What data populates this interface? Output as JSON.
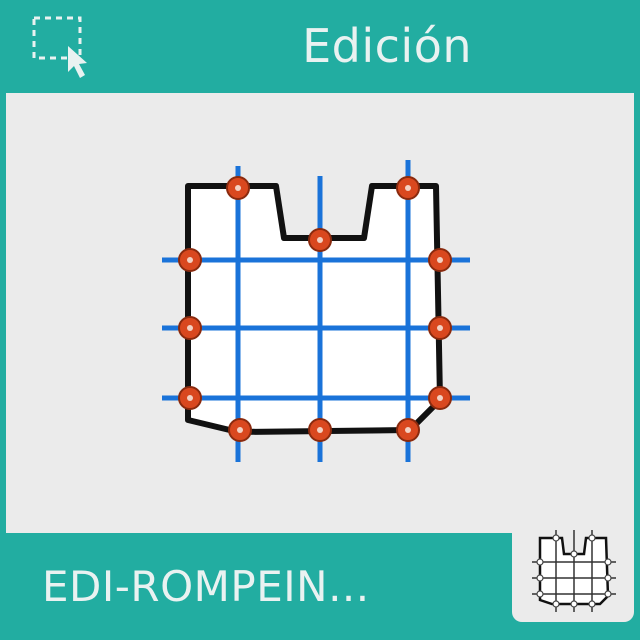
{
  "header": {
    "title": "Edición",
    "select_icon": "dashed-selection-cursor-icon"
  },
  "main": {
    "icon": "mesh-warp-distort-icon"
  },
  "footer": {
    "label": "EDI-ROMPEIN...",
    "badge_icon": "mesh-warp-thumbnail-icon"
  },
  "colors": {
    "accent": "#22ada1",
    "panel": "#ebebeb",
    "mesh_line": "#1a73d9",
    "handle": "#d9481f"
  }
}
